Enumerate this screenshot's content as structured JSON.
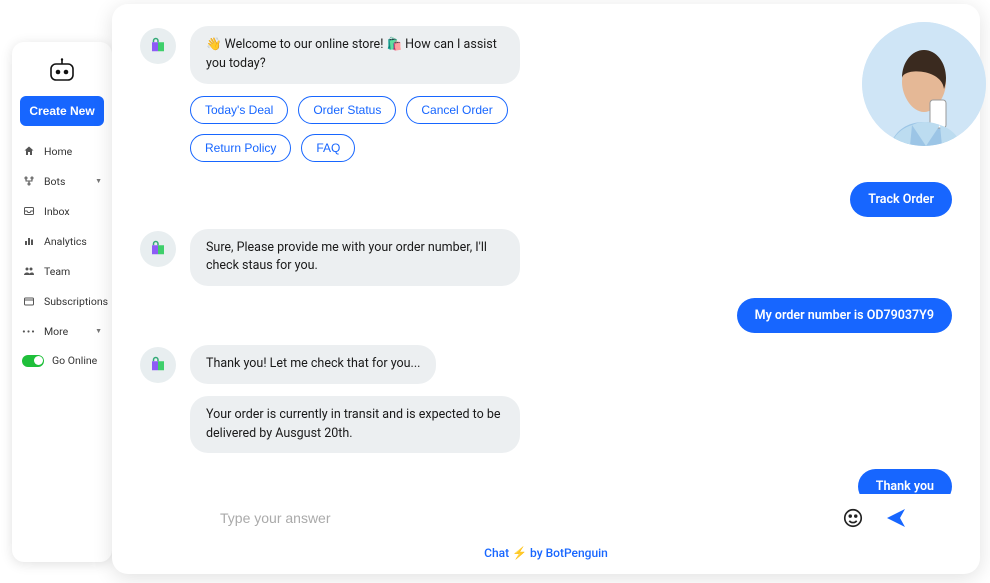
{
  "sidebar": {
    "create_label": "Create New",
    "items": [
      {
        "label": "Home"
      },
      {
        "label": "Bots",
        "expandable": true
      },
      {
        "label": "Inbox"
      },
      {
        "label": "Analytics"
      },
      {
        "label": "Team"
      },
      {
        "label": "Subscriptions"
      },
      {
        "label": "More",
        "expandable": true
      }
    ],
    "go_online_label": "Go Online"
  },
  "chat": {
    "bot_messages": {
      "welcome": "👋 Welcome to our online store! 🛍️ How can I assist you today?",
      "provide_order": "Sure, Please provide me with your order number, I'll check staus for you.",
      "checking": "Thank you! Let me check that for you...",
      "status": "Your order is currently in transit and is expected to be delivered by Ausgust 20th."
    },
    "chips": {
      "deal": "Today's Deal",
      "order_status": "Order Status",
      "cancel": "Cancel Order",
      "return": "Return Policy",
      "faq": "FAQ"
    },
    "user_messages": {
      "track": "Track Order",
      "ordernum": "My order number is  OD79037Y9",
      "thanks": "Thank you"
    },
    "input_placeholder": "Type your answer"
  },
  "footer": {
    "chat": "Chat",
    "bolt": "⚡",
    "by": "by BotPenguin"
  }
}
